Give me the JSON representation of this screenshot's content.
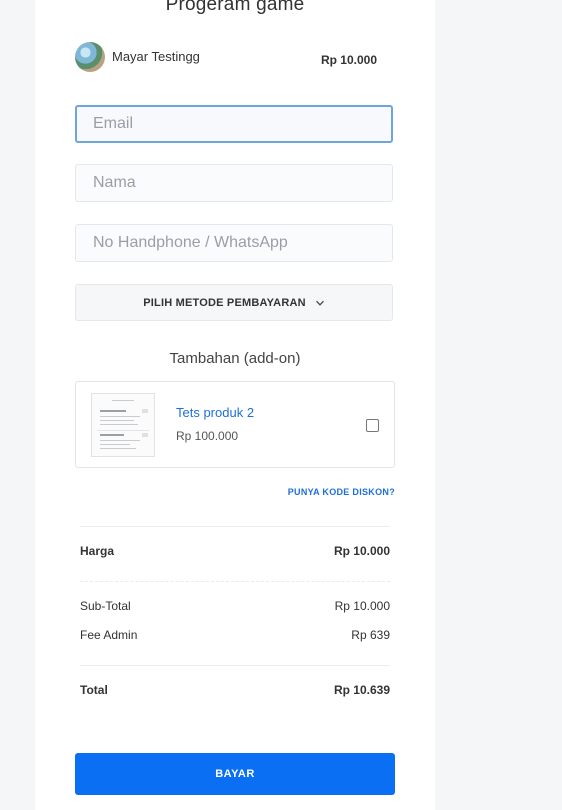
{
  "product_title": "Progeram game",
  "seller": {
    "name": "Mayar Testingg",
    "price": "Rp 10.000"
  },
  "form": {
    "email_placeholder": "Email",
    "name_placeholder": "Nama",
    "phone_placeholder": "No Handphone / WhatsApp",
    "payment_method_label": "PILIH METODE PEMBAYARAN"
  },
  "addons": {
    "title": "Tambahan (add-on)",
    "items": [
      {
        "name": "Tets produk 2",
        "price": "Rp 100.000",
        "checked": false
      }
    ]
  },
  "discount_link": "PUNYA KODE DISKON?",
  "summary": {
    "price_label": "Harga",
    "price_value": "Rp 10.000",
    "subtotal_label": "Sub-Total",
    "subtotal_value": "Rp 10.000",
    "fee_label": "Fee Admin",
    "fee_value": "Rp 639",
    "total_label": "Total",
    "total_value": "Rp 10.639"
  },
  "pay_button": "BAYAR",
  "colors": {
    "accent": "#0a6ff2",
    "link": "#1e6fd9",
    "focus_border": "#6ea5dc"
  }
}
